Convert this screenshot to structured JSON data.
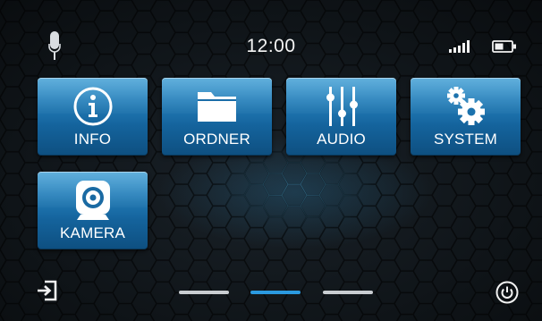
{
  "status_bar": {
    "time": "12:00",
    "icons": [
      "microphone-icon",
      "signal-strength-icon",
      "battery-icon"
    ]
  },
  "tiles": [
    {
      "label": "INFO",
      "icon": "info-icon"
    },
    {
      "label": "ORDNER",
      "icon": "folder-icon"
    },
    {
      "label": "AUDIO",
      "icon": "equalizer-icon"
    },
    {
      "label": "SYSTEM",
      "icon": "gears-icon"
    },
    {
      "label": "KAMERA",
      "icon": "camera-icon"
    }
  ],
  "pager": {
    "pages": 3,
    "active_page": 2
  },
  "bottom_bar": {
    "left_icon": "exit-icon",
    "right_icon": "power-icon"
  },
  "colors": {
    "accent": "#2b9ae0",
    "tile_top": "#3f9fd6",
    "tile_bottom": "#0e4f80",
    "background": "#0f1418"
  }
}
